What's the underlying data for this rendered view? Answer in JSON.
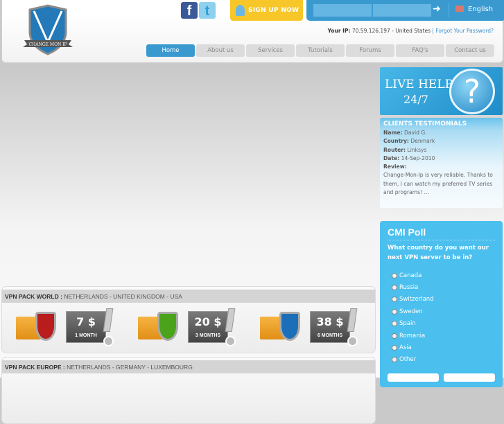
{
  "header": {
    "logo_text": "CHANGE MON IP",
    "social": {
      "facebook": "f",
      "twitter": "t"
    },
    "signup_label": "SIGN UP NOW",
    "login_icon": "arrow-circle-icon",
    "language": "English",
    "ip_label": "Your IP:",
    "ip_value": "70.59.126.197 - United States",
    "separator": "|",
    "forgot_password": "Forgot Your Password?"
  },
  "nav": [
    "Home",
    "About us",
    "Services",
    "Tutorials",
    "Forums",
    "FAQ's",
    "Contact us"
  ],
  "live_help": {
    "line1": "LIVE HELP!",
    "line2": "24/7",
    "icon": "?"
  },
  "testimonials": {
    "title": "CLIENTS TESTIMONIALS",
    "name_label": "Name:",
    "name": "David G.",
    "country_label": "Country:",
    "country": "Denmark",
    "router_label": "Router:",
    "router": "Linksys",
    "date_label": "Date:",
    "date": "14-Sep-2010",
    "review_label": "Review:",
    "review": "Change-Mon-Ip is very reliable. Thanks to them, I can watch my preferred TV series and programs! ..."
  },
  "poll": {
    "title": "CMI Poll",
    "question": "What country do you want our next VPN server to be in?",
    "options": [
      "Canada",
      "Russia",
      "Switzerland",
      "Sweden",
      "Spain",
      "Romania",
      "Asia",
      "Other"
    ]
  },
  "packs": [
    {
      "name": "VPN PACK WORLD :",
      "countries": "NETHERLANDS - UNITED KINGDOM - USA",
      "items": [
        {
          "price": "7 $",
          "duration": "1 MONTH",
          "color": "#b81c1c"
        },
        {
          "price": "20 $",
          "duration": "3 MONTHS",
          "color": "#4aa31a"
        },
        {
          "price": "38 $",
          "duration": "6 MONTHS",
          "color": "#1a6fb8"
        }
      ]
    },
    {
      "name": "VPN PACK EUROPE :",
      "countries": "NETHERLANDS - GERMANY - LUXEMBOURG"
    }
  ]
}
